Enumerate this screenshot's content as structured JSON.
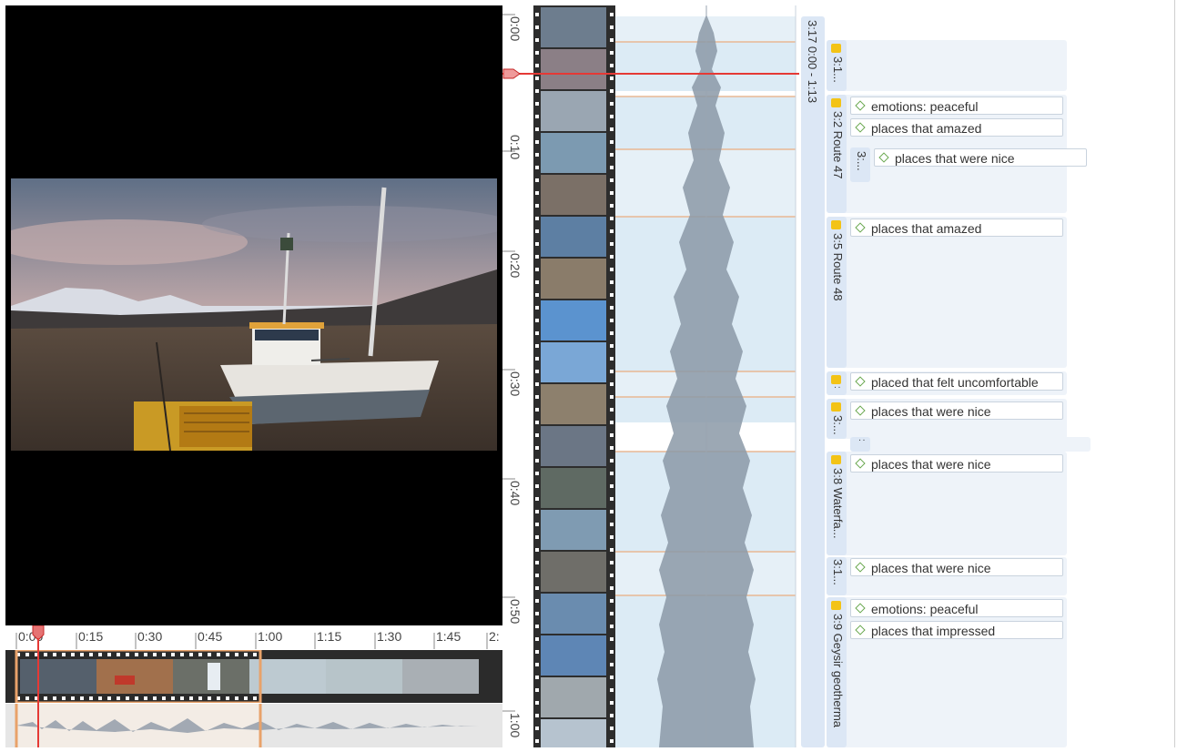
{
  "overview": {
    "ticks": [
      "0:00",
      "0:15",
      "0:30",
      "0:45",
      "1:00",
      "1:15",
      "1:30",
      "1:45",
      "2:"
    ]
  },
  "timeline": {
    "ticks": [
      "0:00",
      "0:10",
      "0:20",
      "0:30",
      "0:40",
      "0:50",
      "1:00"
    ]
  },
  "coding": {
    "column_label": "3:17 0:00 - 1:13",
    "segments": [
      {
        "label": "3:1...",
        "codes": []
      },
      {
        "label": "3:2 Route 47",
        "codes": [
          "emotions: peaceful",
          "places that amazed"
        ]
      },
      {
        "label": "3:...",
        "codes": [
          "places that were nice"
        ]
      },
      {
        "label": "3:5 Route 48",
        "codes": [
          "places that amazed"
        ]
      },
      {
        "label": ":",
        "codes": [
          "placed that felt uncomfortable"
        ]
      },
      {
        "label": "3:...",
        "codes": [
          "places that were nice"
        ]
      },
      {
        "label": ":",
        "codes": []
      },
      {
        "label": "3:8 Waterfa...",
        "codes": [
          "places that were nice"
        ]
      },
      {
        "label": "3:1...",
        "codes": [
          "places that were nice"
        ]
      },
      {
        "label": "3:9 Geysir geotherma",
        "codes": [
          "emotions: peaceful",
          "places that impressed"
        ]
      }
    ]
  },
  "colors": {
    "playhead": "#e53935",
    "selection": "#e8a26a",
    "memo": "#f3c316",
    "code_diamond": "#6aa84f",
    "segment": "#dce7f5"
  }
}
